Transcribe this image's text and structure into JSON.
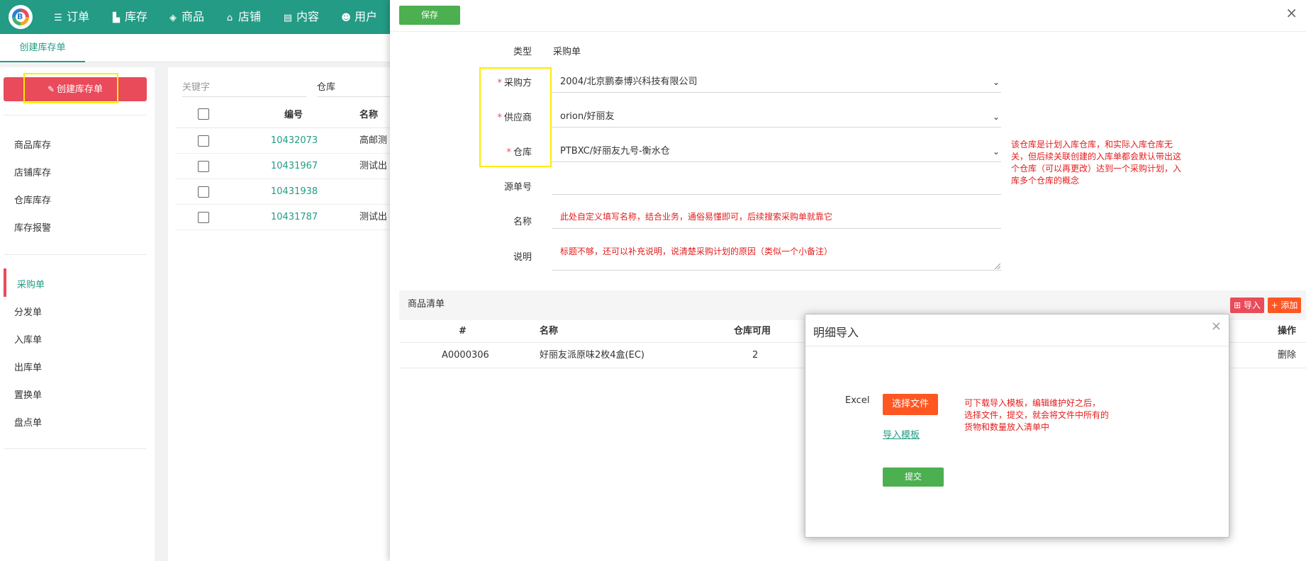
{
  "nav": {
    "items": [
      {
        "icon": "menu-lines-icon",
        "label": "订单"
      },
      {
        "icon": "store-icon",
        "label": "库存"
      },
      {
        "icon": "layers-icon",
        "label": "商品"
      },
      {
        "icon": "shop-icon",
        "label": "店铺"
      },
      {
        "icon": "message-icon",
        "label": "内容"
      },
      {
        "icon": "users-icon",
        "label": "用户"
      }
    ]
  },
  "tabs": {
    "create": "创建库存单"
  },
  "sidebar": {
    "create_button": "创建库存单",
    "group1": [
      "商品库存",
      "店铺库存",
      "仓库库存",
      "库存报警"
    ],
    "group2": [
      "采购单",
      "分发单",
      "入库单",
      "出库单",
      "置换单",
      "盘点单"
    ]
  },
  "list": {
    "filter_keyword_placeholder": "关键字",
    "filter_warehouse_placeholder": "仓库",
    "headers": {
      "code": "编号",
      "name": "名称"
    },
    "rows": [
      {
        "code": "10432073",
        "name": "高邮测"
      },
      {
        "code": "10431967",
        "name": "测试出"
      },
      {
        "code": "10431938",
        "name": ""
      },
      {
        "code": "10431787",
        "name": "测试出"
      }
    ]
  },
  "drawer": {
    "close": "×",
    "save_label": "保存",
    "form": {
      "type_label": "类型",
      "type_value": "采购单",
      "buyer_label": "采购方",
      "buyer_value": "2004/北京鹏泰博兴科技有限公司",
      "supplier_label": "供应商",
      "supplier_value": "orion/好丽友",
      "warehouse_label": "仓库",
      "warehouse_value": "PTBXC/好丽友九号-衡水仓",
      "source_label": "源单号",
      "name_label": "名称",
      "name_value": "此处自定义填写名称，结合业务，通俗易懂即可，后续搜索采购单就靠它",
      "desc_label": "说明",
      "desc_value": "标题不够，还可以补充说明，说清楚采购计划的原因（类似一个小备注）",
      "required_mark": "*"
    },
    "warehouse_note": [
      "该仓库是计划入库仓库，和实际入库仓库无",
      "关，但后续关联创建的入库单都会默认带出这",
      "个仓库（可以再更改）达到一个采购计划，入",
      "库多个仓库的概念"
    ],
    "goods": {
      "title": "商品清单",
      "import_label": "⊞ 导入",
      "add_label": "+ 添加",
      "headers": {
        "index": "#",
        "name": "名称",
        "available": "仓库可用",
        "action": "操作"
      },
      "row": {
        "index": "A0000306",
        "name": "好丽友派原味2枚4盒(EC)",
        "available": "2",
        "action": "删除"
      }
    }
  },
  "modal": {
    "title": "明细导入",
    "close": "×",
    "excel_label": "Excel",
    "choose_file": "选择文件",
    "template_link": "导入模板",
    "submit": "提交",
    "note": [
      "可下载导入模板，编辑维护好之后，",
      "选择文件，提交，就会将文件中所有的",
      "货物和数量放入清单中"
    ]
  },
  "colors": {
    "primary": "#239b85",
    "danger": "#e94b5a",
    "orange": "#ff5722",
    "success": "#4caf50",
    "annotation": "#e41c1c",
    "highlight": "#ffeb00"
  }
}
